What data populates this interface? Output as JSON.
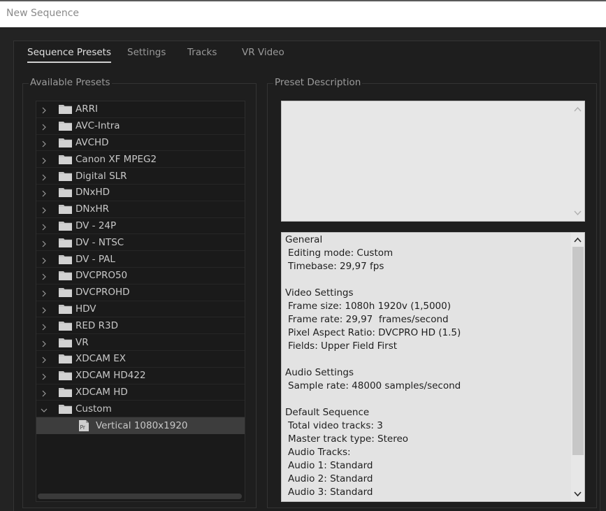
{
  "window": {
    "title": "New Sequence"
  },
  "tabs": [
    {
      "label": "Sequence Presets",
      "active": true
    },
    {
      "label": "Settings",
      "active": false
    },
    {
      "label": "Tracks",
      "active": false
    },
    {
      "label": "VR Video",
      "active": false
    }
  ],
  "presets": {
    "label": "Available Presets",
    "folders": [
      "ARRI",
      "AVC-Intra",
      "AVCHD",
      "Canon XF MPEG2",
      "Digital SLR",
      "DNxHD",
      "DNxHR",
      "DV - 24P",
      "DV - NTSC",
      "DV - PAL",
      "DVCPRO50",
      "DVCPROHD",
      "HDV",
      "RED R3D",
      "VR",
      "XDCAM EX",
      "XDCAM HD422",
      "XDCAM HD"
    ],
    "custom_folder": "Custom",
    "custom_item": "Vertical 1080x1920",
    "custom_item_icon": "Pr"
  },
  "description": {
    "label": "Preset Description",
    "text": "",
    "info": [
      {
        "text": "General",
        "indent": false
      },
      {
        "text": "Editing mode: Custom",
        "indent": true
      },
      {
        "text": "Timebase: 29,97 fps",
        "indent": true
      },
      {
        "text": "",
        "indent": false
      },
      {
        "text": "Video Settings",
        "indent": false
      },
      {
        "text": "Frame size: 1080h 1920v (1,5000)",
        "indent": true
      },
      {
        "text": "Frame rate: 29,97  frames/second",
        "indent": true
      },
      {
        "text": "Pixel Aspect Ratio: DVCPRO HD (1.5)",
        "indent": true
      },
      {
        "text": "Fields: Upper Field First",
        "indent": true
      },
      {
        "text": "",
        "indent": false
      },
      {
        "text": "Audio Settings",
        "indent": false
      },
      {
        "text": "Sample rate: 48000 samples/second",
        "indent": true
      },
      {
        "text": "",
        "indent": false
      },
      {
        "text": "Default Sequence",
        "indent": false
      },
      {
        "text": "Total video tracks: 3",
        "indent": true
      },
      {
        "text": "Master track type: Stereo",
        "indent": true
      },
      {
        "text": "Audio Tracks:",
        "indent": true
      },
      {
        "text": "Audio 1: Standard",
        "indent": true
      },
      {
        "text": "Audio 2: Standard",
        "indent": true
      },
      {
        "text": "Audio 3: Standard",
        "indent": true
      }
    ]
  },
  "colors": {
    "background": "#1e1e1e",
    "selected_row": "#3d3d3d",
    "text_light": "#c8c8c8",
    "info_bg": "#e3e3e3"
  }
}
